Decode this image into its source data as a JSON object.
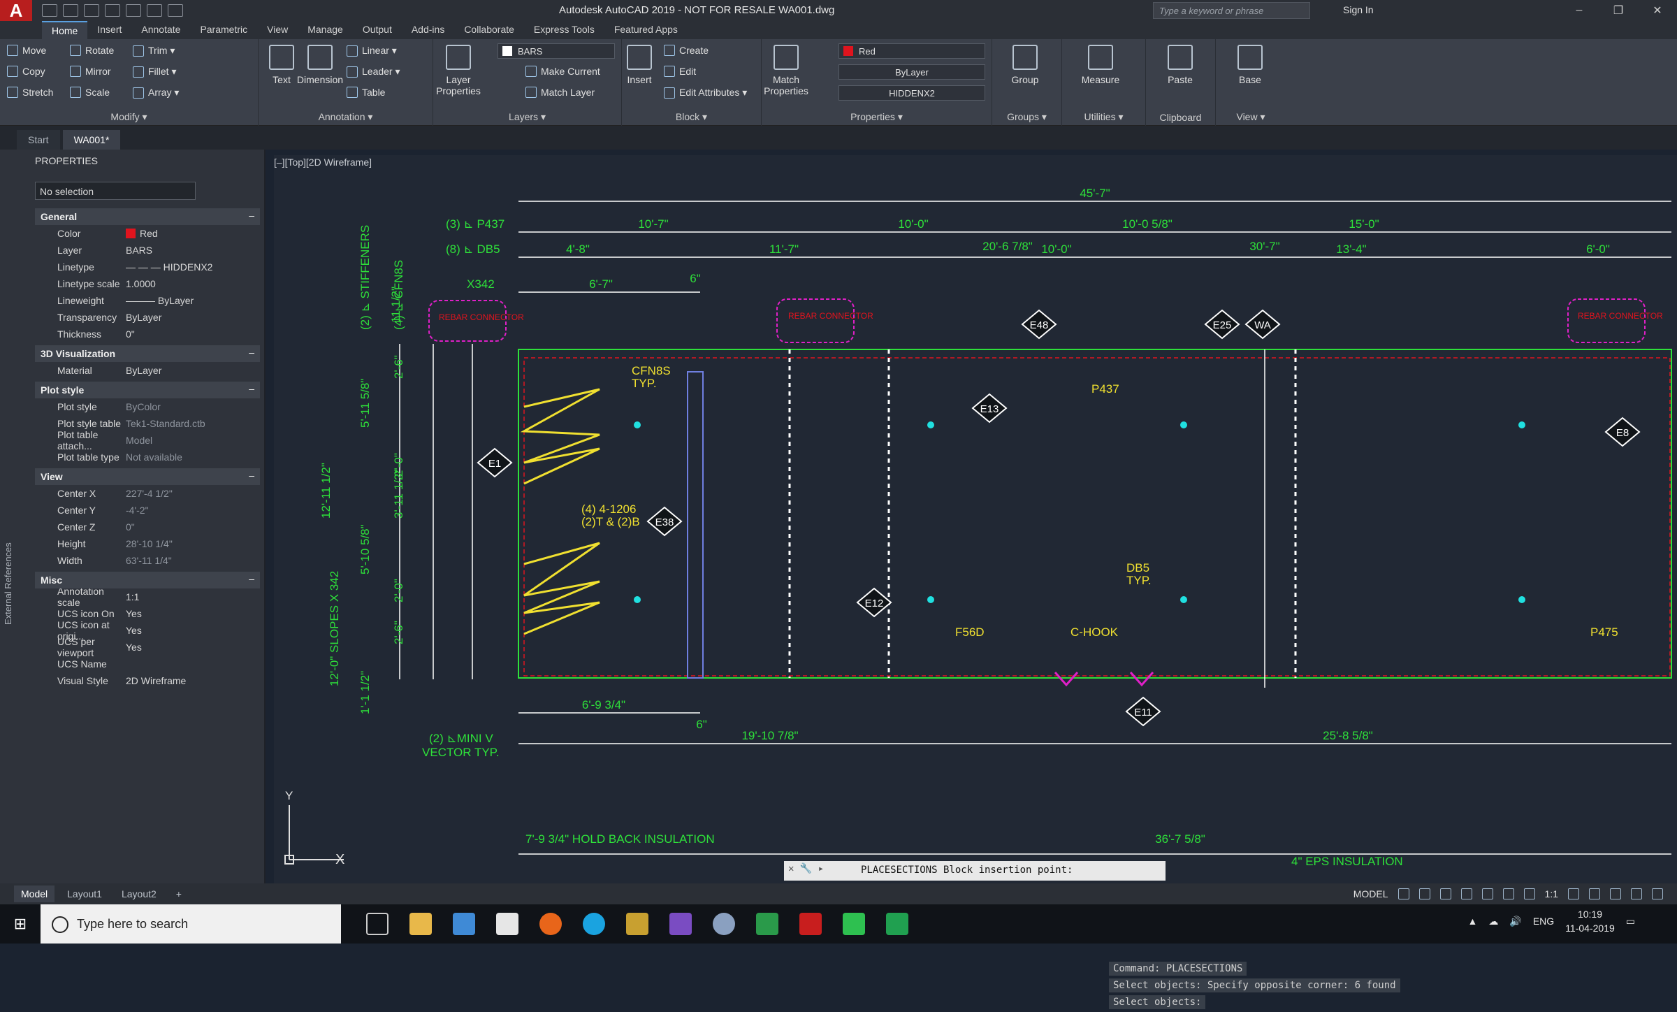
{
  "titlebar": {
    "app_logo": "A",
    "title": "Autodesk AutoCAD 2019 - NOT FOR RESALE    WA001.dwg",
    "search_placeholder": "Type a keyword or phrase",
    "sign_in": "Sign In",
    "minimize": "–",
    "restore": "❐",
    "close": "✕"
  },
  "ribbon_tabs": [
    "Home",
    "Insert",
    "Annotate",
    "Parametric",
    "View",
    "Manage",
    "Output",
    "Add-ins",
    "Collaborate",
    "Express Tools",
    "Featured Apps"
  ],
  "ribbon": {
    "modify": {
      "title": "Modify ▾",
      "move": "Move",
      "rotate": "Rotate",
      "trim": "Trim ▾",
      "copy": "Copy",
      "mirror": "Mirror",
      "fillet": "Fillet ▾",
      "stretch": "Stretch",
      "scale": "Scale",
      "array": "Array ▾"
    },
    "annotation": {
      "title": "Annotation ▾",
      "text": "Text",
      "dimension": "Dimension",
      "linear": "Linear ▾",
      "leader": "Leader ▾",
      "table": "Table"
    },
    "layers": {
      "title": "Layers ▾",
      "layer_properties": "Layer Properties",
      "current_layer": "BARS",
      "make_current": "Make Current",
      "match_layer": "Match Layer"
    },
    "block": {
      "title": "Block ▾",
      "insert": "Insert",
      "create": "Create",
      "edit": "Edit",
      "edit_attributes": "Edit Attributes ▾"
    },
    "properties": {
      "title": "Properties ▾",
      "match_properties": "Match Properties",
      "color": "Red",
      "lineweight": "ByLayer",
      "linetype": "HIDDENX2"
    },
    "groups": {
      "title": "Groups ▾",
      "group": "Group"
    },
    "utilities": {
      "title": "Utilities ▾",
      "measure": "Measure"
    },
    "clipboard": {
      "title": "Clipboard",
      "paste": "Paste"
    },
    "view": {
      "title": "View ▾",
      "base": "Base"
    }
  },
  "doc_tabs": [
    "Start",
    "WA001*"
  ],
  "properties_panel": {
    "header": "PROPERTIES",
    "selection": "No selection",
    "sections": [
      {
        "name": "General",
        "rows": [
          {
            "k": "Color",
            "v": "Red"
          },
          {
            "k": "Layer",
            "v": "BARS"
          },
          {
            "k": "Linetype",
            "v": "— — — HIDDENX2"
          },
          {
            "k": "Linetype scale",
            "v": "1.0000"
          },
          {
            "k": "Lineweight",
            "v": "——— ByLayer"
          },
          {
            "k": "Transparency",
            "v": "ByLayer"
          },
          {
            "k": "Thickness",
            "v": "0\""
          }
        ]
      },
      {
        "name": "3D Visualization",
        "rows": [
          {
            "k": "Material",
            "v": "ByLayer"
          }
        ]
      },
      {
        "name": "Plot style",
        "rows": [
          {
            "k": "Plot style",
            "v": "ByColor"
          },
          {
            "k": "Plot style table",
            "v": "Tek1-Standard.ctb"
          },
          {
            "k": "Plot table attach...",
            "v": "Model"
          },
          {
            "k": "Plot table type",
            "v": "Not available"
          }
        ]
      },
      {
        "name": "View",
        "rows": [
          {
            "k": "Center X",
            "v": "227'-4 1/2\""
          },
          {
            "k": "Center Y",
            "v": "-4'-2\""
          },
          {
            "k": "Center Z",
            "v": "0\""
          },
          {
            "k": "Height",
            "v": "28'-10 1/4\""
          },
          {
            "k": "Width",
            "v": "63'-11 1/4\""
          }
        ]
      },
      {
        "name": "Misc",
        "rows": [
          {
            "k": "Annotation scale",
            "v": "1:1"
          },
          {
            "k": "UCS icon On",
            "v": "Yes"
          },
          {
            "k": "UCS icon at origi...",
            "v": "Yes"
          },
          {
            "k": "UCS per viewport",
            "v": "Yes"
          },
          {
            "k": "UCS Name",
            "v": ""
          },
          {
            "k": "Visual Style",
            "v": "2D Wireframe"
          }
        ]
      }
    ]
  },
  "side_label": "External References",
  "viewport_label": "[–][Top][2D Wireframe]",
  "drawing": {
    "dims": {
      "overall": "45'-7\"",
      "p437_row": [
        "10'-7\"",
        "10'-0\"",
        "10'-0 5/8\"",
        "15'-0\""
      ],
      "db5_row": [
        "4'-8\"",
        "11'-7\"",
        "20'-6 7/8\"",
        "10'-0\"",
        "30'-7\"",
        "13'-4\"",
        "6'-0\""
      ],
      "x342": "6'-7\"",
      "six_in": "6\"",
      "bottom_small": "6'-9 3/4\"",
      "bottom_6in": "6\"",
      "bottom_left": "19'-10 7/8\"",
      "bottom_right": "25'-8 5/8\"",
      "insulation_dim": "36'-7 5/8\""
    },
    "labels": {
      "p437": "(3) ⊾ P437",
      "db5": "(8) ⊾ DB5",
      "x342": "X342",
      "stiffeners": "(2) ⊾ STIFFENERS",
      "cfn8s_vert": "(4) ⊾ CFN8S",
      "cfn8s": "CFN8S",
      "typ": "TYP.",
      "bolts_1": "(4) 4-1206",
      "bolts_2": "(2)T & (2)B",
      "p437_tag": "P437",
      "db5_tag": "DB5",
      "db5_typ": "TYP.",
      "f56d": "F56D",
      "chook": "C-HOOK",
      "p475": "P475",
      "mini_v_1": "(2) ⊾MINI V",
      "mini_v_2": "VECTOR TYP.",
      "hold_back": "7'-9 3/4\" HOLD BACK INSULATION",
      "eps": "4\" EPS INSULATION",
      "slopes": "12'-0\" SLOPES X 342",
      "rebar_tag": "REBAR CONNECTOR"
    },
    "vert_dims": [
      "11 1/2\"",
      "12'-11 1/2\"",
      "2'-6\"",
      "5'-11 5/8\"",
      "2'-0\"",
      "3'-11 1/2\"",
      "5'-10 5/8\"",
      "2'-0\"",
      "2'-6\"",
      "1'-1 1/2\""
    ],
    "markers": [
      "E1",
      "E38",
      "E48",
      "E13",
      "E25",
      "WA",
      "E8",
      "E12",
      "E11"
    ]
  },
  "command": {
    "history": [
      "Command: PLACESECTIONS",
      "Select objects: Specify opposite corner: 6 found",
      "Select objects:"
    ],
    "prompt_prefix": "✕ 🔧 ▸",
    "input": "PLACESECTIONS Block insertion point:"
  },
  "layout_tabs": [
    "Model",
    "Layout1",
    "Layout2",
    "+"
  ],
  "status": {
    "model": "MODEL",
    "scale": "1:1"
  },
  "taskbar": {
    "search": "Type here to search",
    "lang": "ENG",
    "time": "10:19",
    "date": "11-04-2019"
  },
  "colors": {
    "canvas": "#212834",
    "accent_green": "#2ee03a",
    "magenta": "#e020c8",
    "red": "#e0141e",
    "yellow": "#f0e030",
    "cyan": "#20e0e0"
  }
}
